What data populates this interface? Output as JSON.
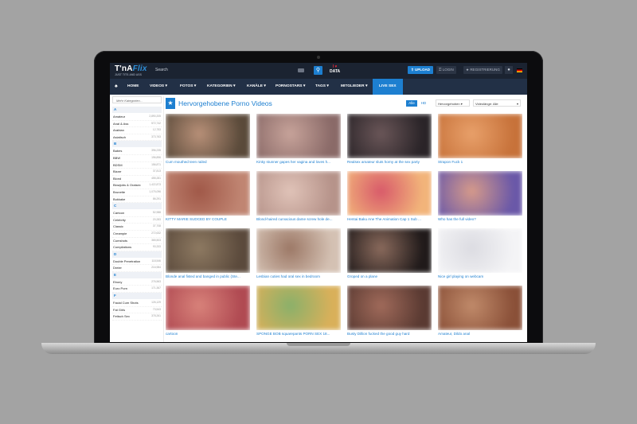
{
  "header": {
    "logo_main": "T'nA",
    "logo_accent": "Flix",
    "tagline": "JUST TITS AND ASS",
    "search_label": "Search",
    "data_logo_top": "I ♥",
    "data_logo_bottom": "DATA",
    "upload_label": "UPLOAD",
    "login_label": "LOGIN",
    "register_label": "REGISTRIERUNG"
  },
  "nav": {
    "items": [
      "HOME",
      "VIDEOS",
      "FOTOS",
      "KATEGORIEN",
      "KANÄLE",
      "PORNOSTARS",
      "TAGS",
      "MITGLIEDER",
      "LIVE SEX"
    ]
  },
  "sidebar": {
    "more_label": "Mehr Kategorien...",
    "groups": [
      {
        "letter": "A",
        "items": [
          [
            "Amateur",
            "2,890,205"
          ],
          [
            "Anal & Ass",
            "572,742"
          ],
          [
            "Arabian",
            "12,753"
          ],
          [
            "Asiatisch",
            "373,763"
          ]
        ]
      },
      {
        "letter": "B",
        "items": [
          [
            "Babes",
            "396,235"
          ],
          [
            "BBW",
            "196,896"
          ],
          [
            "BDSM",
            "156,871"
          ],
          [
            "Bizarr",
            "37,813"
          ],
          [
            "Blond",
            "455,281"
          ],
          [
            "Blowjobs & Oralsex",
            "1,422,873"
          ],
          [
            "Brunette",
            "1,075,096"
          ],
          [
            "Bukkake",
            "86,291"
          ]
        ]
      },
      {
        "letter": "C",
        "items": [
          [
            "Cartoon",
            "52,988"
          ],
          [
            "Celebrity",
            "20,283"
          ],
          [
            "Classic",
            "37,708"
          ],
          [
            "Creampie",
            "272,632"
          ],
          [
            "Cumshots",
            "365,503"
          ],
          [
            "Compilations",
            "93,333"
          ]
        ]
      },
      {
        "letter": "D",
        "items": [
          [
            "Double Penetration",
            "118,546"
          ],
          [
            "Dreier",
            "216,984"
          ]
        ]
      },
      {
        "letter": "E",
        "items": [
          [
            "Ebony",
            "276,563"
          ],
          [
            "Euro Porn",
            "171,367"
          ]
        ]
      },
      {
        "letter": "F",
        "items": [
          [
            "Facial Cum Shots",
            "126,129"
          ],
          [
            "Fat Girls",
            "73,543"
          ],
          [
            "Fetisch Sex",
            "378,261"
          ]
        ]
      }
    ]
  },
  "main": {
    "title": "Hervorgehobene Porno Videos",
    "filter_all": "Alle",
    "filter_hd": "HD",
    "sort_label": "Hervorgehoben",
    "length_label": "Videolänge: Alle"
  },
  "videos": [
    {
      "title": "Cum mouthed teen railed",
      "colors": [
        "#5a4a3a",
        "#b89078"
      ]
    },
    {
      "title": "Kinky stunner gapes her vagina and loves h...",
      "colors": [
        "#8a6a68",
        "#c7a39a"
      ]
    },
    {
      "title": "Realsex amateur sluts horny at the sex party",
      "colors": [
        "#2a2428",
        "#6a5658"
      ]
    },
    {
      "title": "Strapon Fuck 1",
      "colors": [
        "#c7723a",
        "#e8a06a"
      ]
    },
    {
      "title": "KITTY MARIE SUDCED BY COUPLE",
      "colors": [
        "#c08572",
        "#a05848"
      ]
    },
    {
      "title": "Blond-haired curvacious dame screw hole de...",
      "colors": [
        "#b6938a",
        "#e0c3b8"
      ]
    },
    {
      "title": "Hentai Baku Ane The Animation Cap 1 Sub ...",
      "colors": [
        "#f2b47a",
        "#d85a6a"
      ]
    },
    {
      "title": "Who has the full video?",
      "colors": [
        "#6a58a8",
        "#d69a8a"
      ]
    },
    {
      "title": "Blonde anal fisted and banged in public (Ste...",
      "colors": [
        "#5b4a3c",
        "#8e7a62"
      ]
    },
    {
      "title": "Lesbian cuties had oral sex in bedroom",
      "colors": [
        "#d4c1b3",
        "#9c7866"
      ]
    },
    {
      "title": "Groped on a plane",
      "colors": [
        "#201a1a",
        "#8a6a5c"
      ]
    },
    {
      "title": "Nice girl playing on webcam",
      "colors": [
        "#f4f4f6",
        "#dcdce2"
      ]
    },
    {
      "title": "cartoon",
      "colors": [
        "#b04a52",
        "#d8827a"
      ]
    },
    {
      "title": "SPONGE BOB squarepants PORN SEX 18...",
      "colors": [
        "#d9b05a",
        "#8ab06a"
      ]
    },
    {
      "title": "Busty Dillion fucked the good guy hard",
      "colors": [
        "#5a3a32",
        "#a06a5a"
      ]
    },
    {
      "title": "Amateur, Dildo anal",
      "colors": [
        "#8a5038",
        "#c08a6a"
      ]
    }
  ]
}
